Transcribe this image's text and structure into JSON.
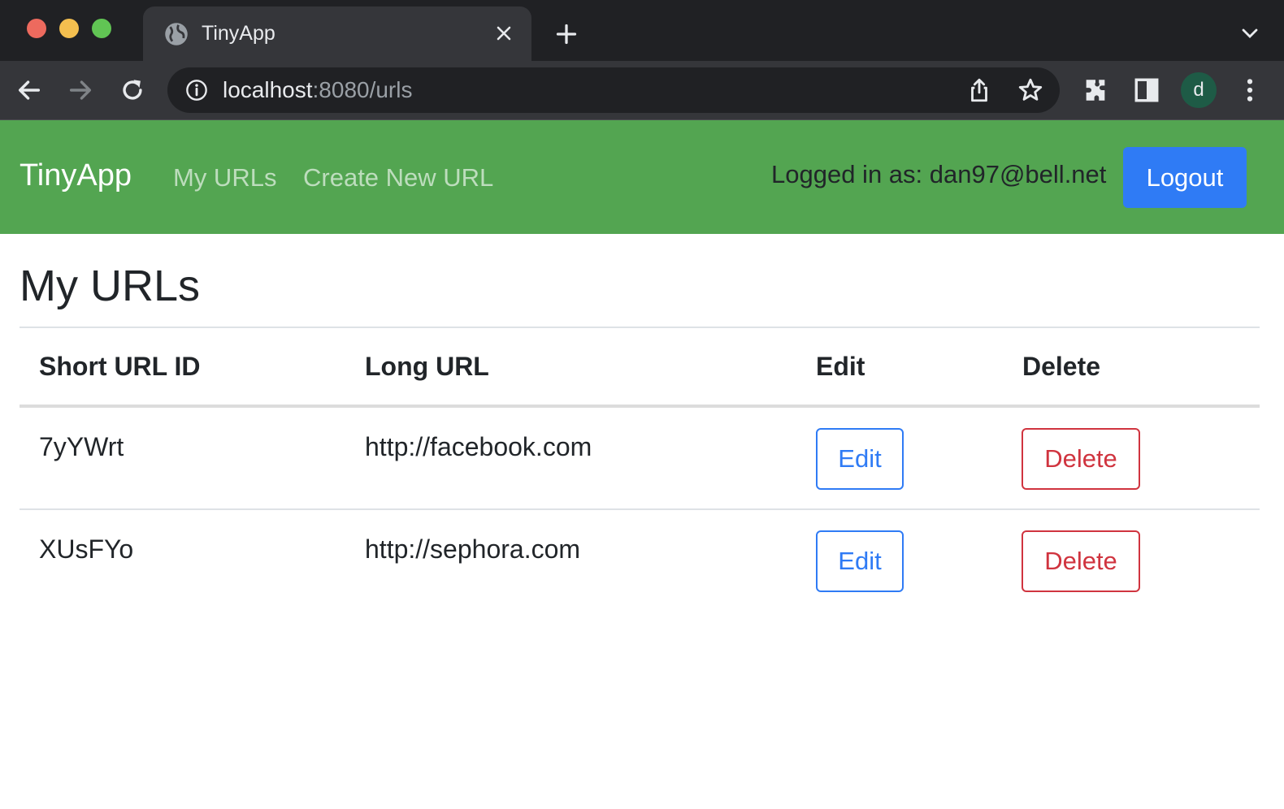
{
  "browser": {
    "tab_title": "TinyApp",
    "tab_icon": "globe-icon",
    "url_host": "localhost",
    "url_path": ":8080/urls",
    "profile_initial": "d",
    "profile_color": "#1e5b46"
  },
  "navbar": {
    "brand": "TinyApp",
    "links": [
      "My URLs",
      "Create New URL"
    ],
    "logged_in_text": "Logged in as: dan97@bell.net",
    "logout_label": "Logout",
    "bg_color": "#53a551",
    "button_color": "#2f7bf5"
  },
  "main": {
    "title": "My URLs",
    "columns": [
      "Short URL ID",
      "Long URL",
      "Edit",
      "Delete"
    ],
    "rows": [
      {
        "short_id": "7yYWrt",
        "long_url": "http://facebook.com",
        "edit_label": "Edit",
        "delete_label": "Delete"
      },
      {
        "short_id": "XUsFYo",
        "long_url": "http://sephora.com",
        "edit_label": "Edit",
        "delete_label": "Delete"
      }
    ],
    "edit_color": "#2f7bf5",
    "delete_color": "#d0343f"
  }
}
